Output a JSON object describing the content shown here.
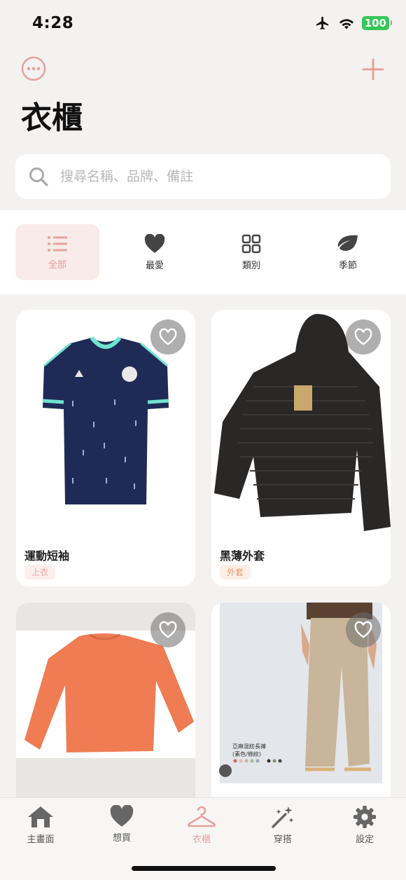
{
  "status_bar": {
    "time": "4:28",
    "battery": "100"
  },
  "header": {
    "title": "衣櫃"
  },
  "search": {
    "placeholder": "搜尋名稱、品牌、備註"
  },
  "filters": [
    {
      "label": "全部",
      "icon": "list-icon",
      "active": true
    },
    {
      "label": "最愛",
      "icon": "heart-icon",
      "active": false
    },
    {
      "label": "類別",
      "icon": "grid-icon",
      "active": false
    },
    {
      "label": "季節",
      "icon": "leaf-icon",
      "active": false
    }
  ],
  "items": [
    {
      "name": "運動短袖",
      "category": "上衣",
      "image": "navy football jersey"
    },
    {
      "name": "黑薄外套",
      "category": "外套",
      "image": "black hooded down jacket"
    },
    {
      "name": "",
      "category": "",
      "image": "orange sweatshirt"
    },
    {
      "name": "",
      "category": "",
      "image": "beige wide-leg pants",
      "image_text": [
        "亞麻混紡長褲",
        "(素色/條紋)"
      ]
    }
  ],
  "tab_bar": [
    {
      "label": "主畫面",
      "icon": "home-icon",
      "active": false
    },
    {
      "label": "想買",
      "icon": "heart-icon",
      "active": false
    },
    {
      "label": "衣櫃",
      "icon": "hanger-icon",
      "active": true
    },
    {
      "label": "穿搭",
      "icon": "magic-wand-icon",
      "active": false
    },
    {
      "label": "設定",
      "icon": "gear-icon",
      "active": false
    }
  ],
  "colors": {
    "accent": "#e7a29c",
    "background": "#f4f2f1"
  }
}
